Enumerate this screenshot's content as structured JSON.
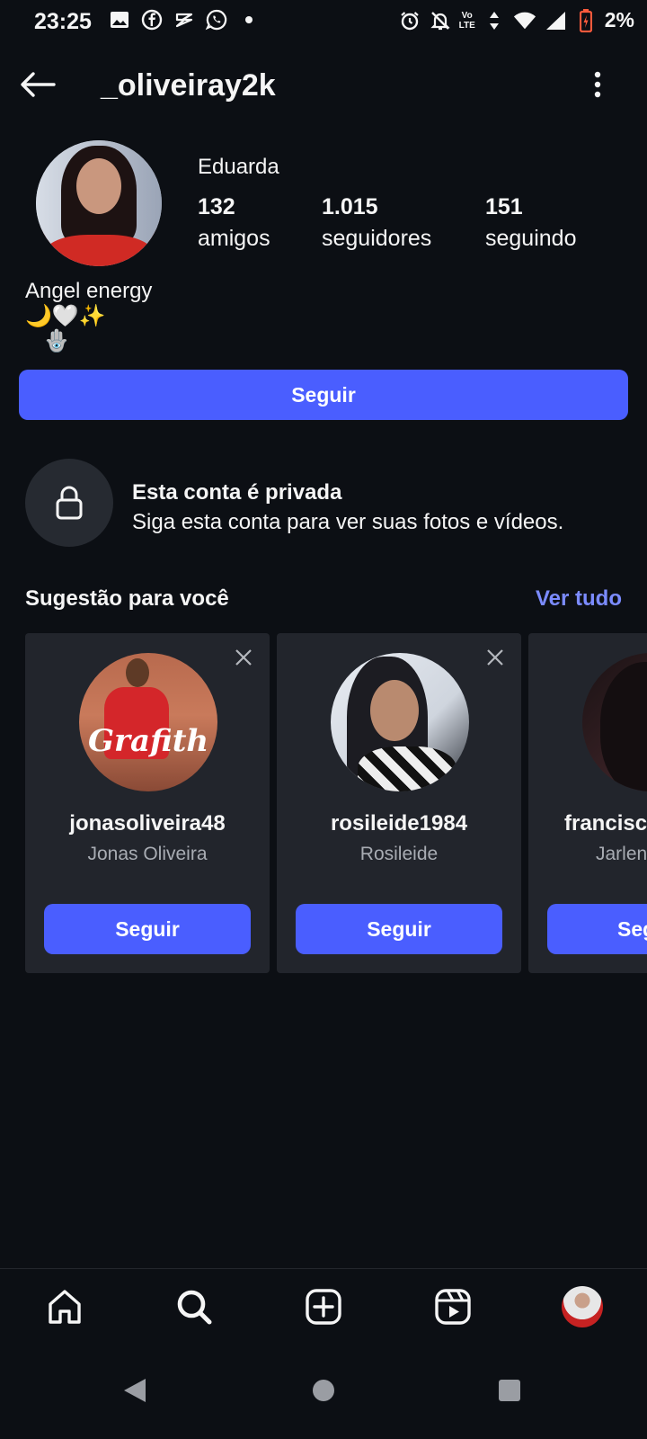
{
  "status_bar": {
    "time": "23:25",
    "battery": "2%",
    "network_label_top": "Vo",
    "network_label_bottom": "LTE",
    "icons": [
      "gallery-icon",
      "facebook-icon",
      "tinder-icon",
      "whatsapp-icon",
      "dot-icon",
      "alarm-icon",
      "notifications-off-icon",
      "volte-icon",
      "wifi-icon",
      "signal-icon",
      "battery-icon"
    ],
    "battery_color": "#ff5a3c"
  },
  "header": {
    "username": "_oliveiray2k"
  },
  "profile": {
    "display_name": "Eduarda",
    "stats": [
      {
        "value": "132",
        "label": "amigos"
      },
      {
        "value": "1.015",
        "label": "seguidores"
      },
      {
        "value": "151",
        "label": "seguindo"
      }
    ],
    "bio_line1": "Angel energy",
    "bio_line2": "🌙🤍✨",
    "bio_line3": "🪬",
    "follow_label": "Seguir"
  },
  "private": {
    "title": "Esta conta é privada",
    "subtitle": "Siga esta conta para ver suas fotos e vídeos."
  },
  "suggestions": {
    "title": "Sugestão para você",
    "see_all": "Ver tudo",
    "cards": [
      {
        "username": "jonasoliveira48",
        "name": "Jonas Oliveira",
        "follow": "Seguir",
        "avatar_text": "Grafith"
      },
      {
        "username": "rosileide1984",
        "name": "Rosileide",
        "follow": "Seguir"
      },
      {
        "username": "francisc",
        "name": "Jarlen",
        "follow": "Seg"
      }
    ]
  },
  "colors": {
    "background": "#0c0f14",
    "accent": "#4a5eff",
    "link": "#7b8bff",
    "card": "#22252c"
  },
  "bottom_nav": {
    "items": [
      "home-icon",
      "search-icon",
      "create-icon",
      "reels-icon",
      "profile-avatar"
    ]
  }
}
